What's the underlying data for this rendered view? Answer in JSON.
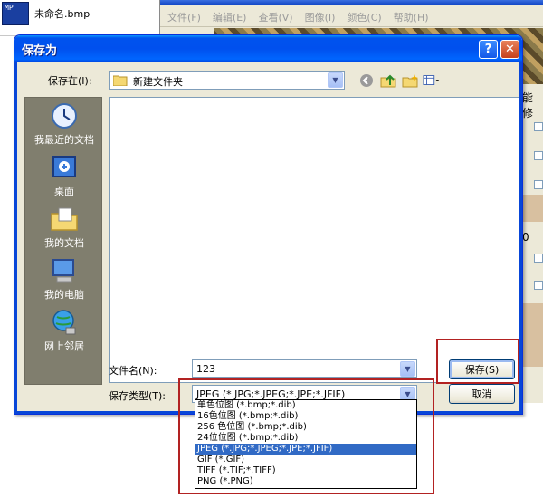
{
  "background": {
    "explorer_file": "未命名.bmp",
    "bmp_icon_text": "MP",
    "paint_menu": [
      "文件(F)",
      "编辑(E)",
      "查看(V)",
      "图像(I)",
      "颜色(C)",
      "帮助(H)"
    ],
    "right_panel_text": "能修",
    "right_panel_value": "0"
  },
  "dialog": {
    "title": "保存为",
    "help_label": "?",
    "close_label": "✕",
    "save_in_label": "保存在(I):",
    "save_in_value": "新建文件夹",
    "places": [
      "我最近的文档",
      "桌面",
      "我的文档",
      "我的电脑",
      "网上邻居"
    ],
    "filename_label": "文件名(N):",
    "filename_value": "123",
    "filetype_label": "保存类型(T):",
    "filetype_value": "JPEG (*.JPG;*.JPEG;*.JPE;*.JFIF)",
    "save_button": "保存(S)",
    "cancel_button": "取消",
    "filetype_options": [
      "单色位图 (*.bmp;*.dib)",
      "16色位图 (*.bmp;*.dib)",
      "256 色位图 (*.bmp;*.dib)",
      "24位位图 (*.bmp;*.dib)",
      "JPEG (*.JPG;*.JPEG;*.JPE;*.JFIF)",
      "GIF (*.GIF)",
      "TIFF (*.TIF;*.TIFF)",
      "PNG (*.PNG)"
    ],
    "selected_option_index": 4
  },
  "colors": {
    "titlebar": "#0053ee",
    "selection": "#316ac5",
    "highlight_box": "#b22222"
  }
}
